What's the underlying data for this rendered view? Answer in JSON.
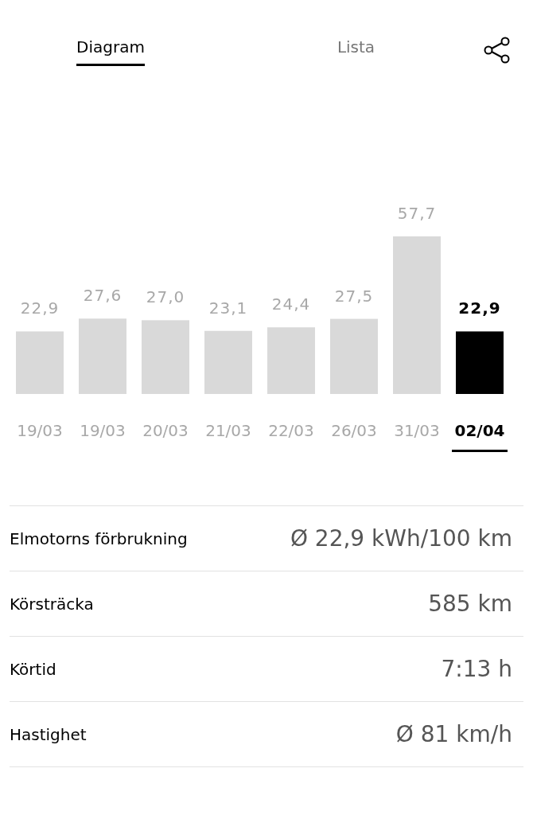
{
  "tabs": [
    {
      "label": "Diagram",
      "selected": true
    },
    {
      "label": "Lista",
      "selected": false
    }
  ],
  "chart": {
    "chart_data": {
      "type": "bar",
      "categories": [
        "19/03",
        "19/03",
        "20/03",
        "21/03",
        "22/03",
        "26/03",
        "31/03",
        "02/04"
      ],
      "series": [
        {
          "values": [
            22.9,
            27.6,
            27.0,
            23.1,
            24.4,
            27.5,
            57.7,
            22.9
          ],
          "value_labels": [
            "22,9",
            "27,6",
            "27,0",
            "23,1",
            "24,4",
            "27,5",
            "57,7",
            "22,9"
          ]
        }
      ]
    },
    "selected": [
      false,
      false,
      false,
      false,
      false,
      false,
      false,
      true
    ]
  },
  "stats": [
    {
      "label": "Elmotorns förbrukning",
      "value": "Ø 22,9 kWh/100 km"
    },
    {
      "label": "Körsträcka",
      "value": "585 km"
    },
    {
      "label": "Körtid",
      "value": "7:13 h"
    },
    {
      "label": "Hastighet",
      "value": "Ø 81 km/h"
    }
  ]
}
